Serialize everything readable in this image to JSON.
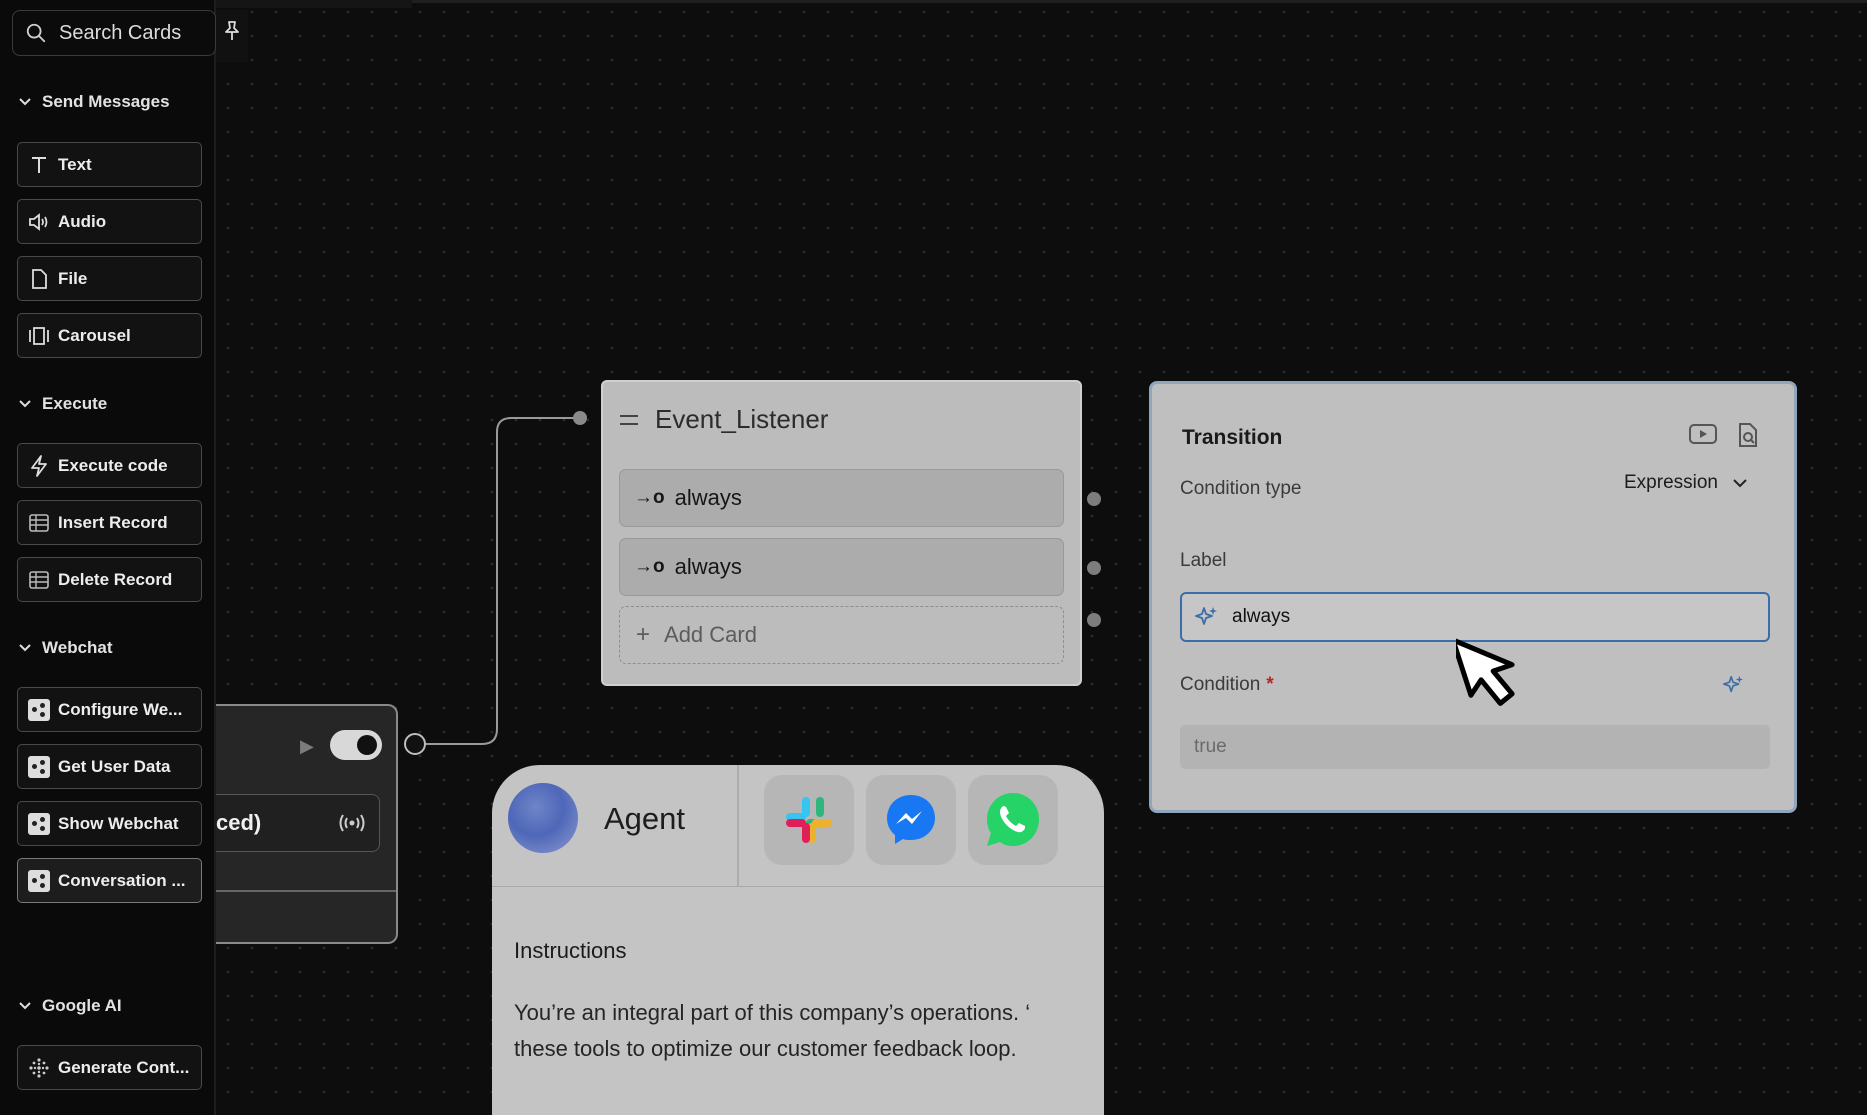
{
  "sidebar": {
    "search_placeholder": "Search Cards",
    "sections": [
      {
        "title": "Send Messages",
        "items": [
          "Text",
          "Audio",
          "File",
          "Carousel"
        ]
      },
      {
        "title": "Execute",
        "items": [
          "Execute code",
          "Insert Record",
          "Delete Record"
        ]
      },
      {
        "title": "Webchat",
        "items": [
          "Configure We...",
          "Get User Data",
          "Show Webchat",
          "Conversation ..."
        ]
      },
      {
        "title": "Google AI",
        "items": [
          "Generate Cont..."
        ]
      }
    ]
  },
  "left_node": {
    "row_text": "ced)"
  },
  "event_listener": {
    "title": "Event_Listener",
    "transitions": [
      "always",
      "always"
    ],
    "add_card_label": "Add Card",
    "transition_glyph": "→o"
  },
  "transition_panel": {
    "title": "Transition",
    "condition_type_label": "Condition type",
    "condition_type_value": "Expression",
    "label_label": "Label",
    "label_value": "always",
    "condition_label": "Condition",
    "required_marker": "*",
    "condition_value": "true"
  },
  "agent_card": {
    "name": "Agent",
    "instructions_heading": "Instructions",
    "instructions_line1": "You’re an integral part of this company’s operations. ‘",
    "instructions_line2": "these tools to optimize our customer feedback loop."
  },
  "colors": {
    "canvas": "#0d0d0d",
    "accent_blue": "#3b6ea8",
    "slack_red": "#e01e5a",
    "slack_green": "#2eb67d",
    "slack_blue": "#36c5f0",
    "slack_yellow": "#ecb22e",
    "messenger_blue": "#1877f2",
    "whatsapp_green": "#25d366"
  }
}
